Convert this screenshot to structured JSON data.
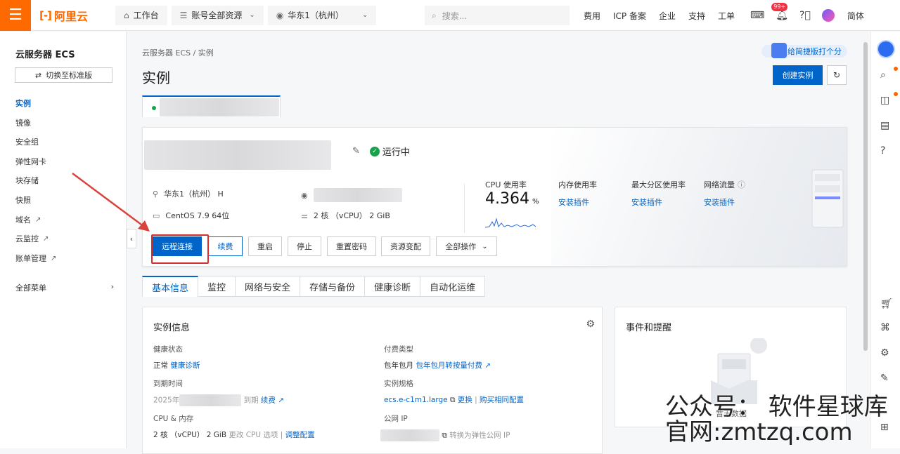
{
  "topbar": {
    "logo": "阿里云",
    "workbench": "工作台",
    "resources": "账号全部资源",
    "region": "华东1（杭州）",
    "search_placeholder": "搜索...",
    "links": [
      "费用",
      "ICP 备案",
      "企业",
      "支持",
      "工单"
    ],
    "notify_badge": "99+",
    "lang": "简体"
  },
  "sidebar": {
    "title": "云服务器 ECS",
    "switch_label": "切换至标准版",
    "items": [
      "实例",
      "镜像",
      "安全组",
      "弹性网卡",
      "块存储",
      "快照",
      "域名",
      "云监控",
      "账单管理"
    ],
    "more": "全部菜单"
  },
  "main": {
    "breadcrumb": "云服务器 ECS / 实例",
    "title": "实例",
    "rate_label": "给简捷版打个分",
    "create_label": "创建实例"
  },
  "instance": {
    "status": "运行中",
    "region": "华东1（杭州） H",
    "os": "CentOS 7.9 64位",
    "spec": "2 核 （vCPU） 2 GiB",
    "metrics": {
      "cpu_label": "CPU 使用率",
      "cpu_value": "4.364",
      "cpu_unit": "%",
      "mem_label": "内存使用率",
      "disk_label": "最大分区使用率",
      "net_label": "网络流量",
      "install": "安装插件"
    },
    "buttons": [
      "远程连接",
      "续费",
      "重启",
      "停止",
      "重置密码",
      "资源变配",
      "全部操作"
    ]
  },
  "tabs": [
    "基本信息",
    "监控",
    "网络与安全",
    "存储与备份",
    "健康诊断",
    "自动化运维"
  ],
  "info": {
    "title": "实例信息",
    "health_label": "健康状态",
    "health_value": "正常",
    "health_link": "健康诊断",
    "pay_label": "付费类型",
    "pay_value": "包年包月",
    "pay_link": "包年包月转按量付费",
    "expire_label": "到期时间",
    "expire_prefix": "2025年",
    "expire_suffix": "到期",
    "renew_link": "续费",
    "spec_label": "实例规格",
    "spec_value": "ecs.e-c1m1.large",
    "spec_change": "更换",
    "spec_buy": "购买相同配置",
    "cpu_mem_label": "CPU & 内存",
    "cpu_mem_value": "2 核 （vCPU） 2 GiB",
    "cpu_opt": "更改 CPU 选项",
    "adjust": "调整配置",
    "ip_label": "公网 IP",
    "ip_convert": "转换为弹性公网 IP"
  },
  "events": {
    "title": "事件和提醒",
    "empty": "暂无数据"
  },
  "watermark": {
    "line1": "公众号： 软件星球库",
    "line2": "官网:zmtzq.com"
  }
}
